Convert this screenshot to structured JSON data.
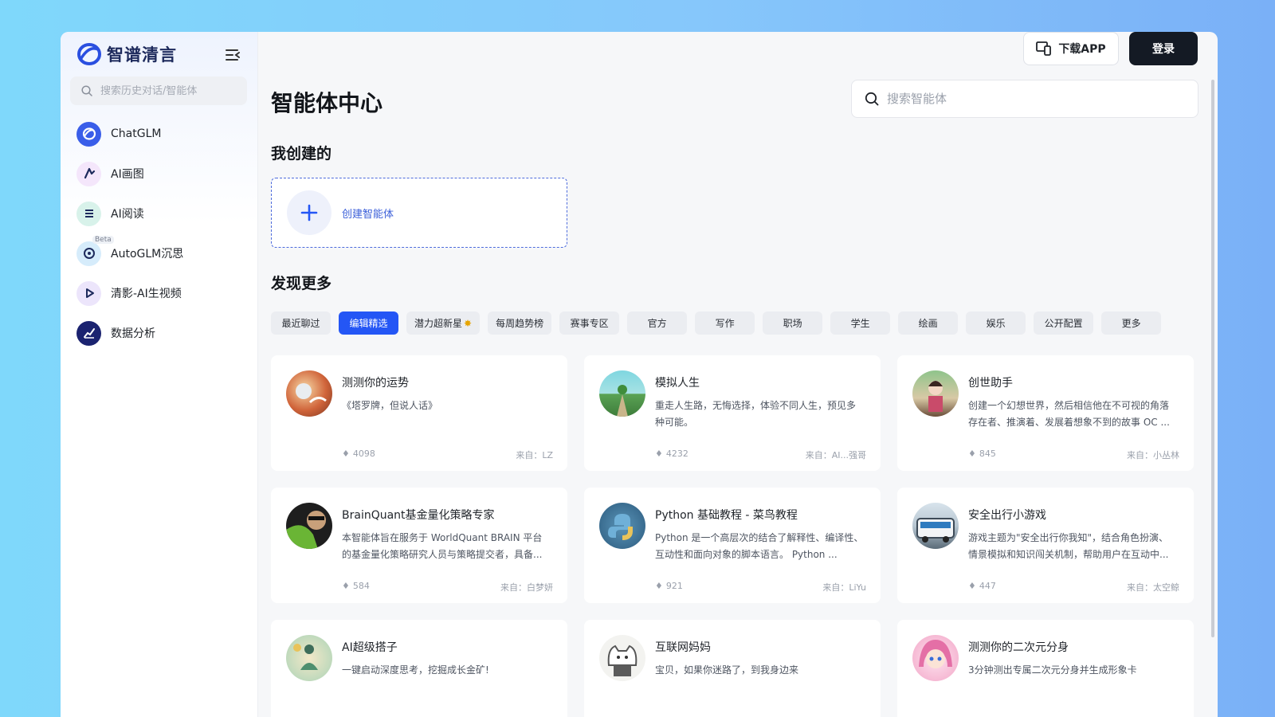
{
  "app": {
    "name": "智谱清言"
  },
  "sidebar": {
    "search_placeholder": "搜索历史对话/智能体",
    "items": [
      {
        "label": "ChatGLM",
        "icon": "chatglm-logo-icon",
        "color": "#3a5ee9"
      },
      {
        "label": "AI画图",
        "icon": "paint-icon",
        "color": "#f4e6fb"
      },
      {
        "label": "AI阅读",
        "icon": "reading-icon",
        "color": "#d8f2ea"
      },
      {
        "label": "AutoGLM沉思",
        "icon": "think-icon",
        "color": "#d6ecfb",
        "badge": "Beta"
      },
      {
        "label": "清影-AI生视频",
        "icon": "play-icon",
        "color": "#ece5fb"
      },
      {
        "label": "数据分析",
        "icon": "chart-icon",
        "color": "#1b2370"
      }
    ]
  },
  "header": {
    "download_label": "下载APP",
    "login_label": "登录"
  },
  "main": {
    "title": "智能体中心",
    "search_placeholder": "搜索智能体",
    "my_created_title": "我创建的",
    "create_label": "创建智能体",
    "discover_title": "发现更多",
    "tabs": [
      {
        "label": "最近聊过",
        "active": false
      },
      {
        "label": "编辑精选",
        "active": true
      },
      {
        "label": "潜力超新星",
        "active": false
      },
      {
        "label": "每周趋势榜",
        "active": false
      },
      {
        "label": "赛事专区",
        "active": false
      },
      {
        "label": "官方",
        "active": false
      },
      {
        "label": "写作",
        "active": false
      },
      {
        "label": "职场",
        "active": false
      },
      {
        "label": "学生",
        "active": false
      },
      {
        "label": "绘画",
        "active": false
      },
      {
        "label": "娱乐",
        "active": false
      },
      {
        "label": "公开配置",
        "active": false
      },
      {
        "label": "更多",
        "active": false
      }
    ],
    "cards": [
      {
        "title": "测测你的运势",
        "desc": "《塔罗牌，但说人话》",
        "count": "4098",
        "source": "来自：LZ"
      },
      {
        "title": "模拟人生",
        "desc": "重走人生路，无悔选择，体验不同人生，预见多种可能。",
        "count": "4232",
        "source": "来自：AI...强哥"
      },
      {
        "title": "创世助手",
        "desc": "创建一个幻想世界，然后相信他在不可视的角落存在者、推演着、发展着想象不到的故事 OC ...",
        "count": "845",
        "source": "来自：小丛林"
      },
      {
        "title": "BrainQuant基金量化策略专家",
        "desc": "本智能体旨在服务于 WorldQuant BRAIN 平台的基金量化策略研究人员与策略提交者，具备...",
        "count": "584",
        "source": "来自：白梦妍"
      },
      {
        "title": "Python 基础教程 - 菜鸟教程",
        "desc": "Python 是一个高层次的结合了解释性、编译性、互动性和面向对象的脚本语言。 Python ...",
        "count": "921",
        "source": "来自：LiYu"
      },
      {
        "title": "安全出行小游戏",
        "desc": "游戏主题为\"安全出行你我知\"，结合角色扮演、情景模拟和知识闯关机制，帮助用户在互动中...",
        "count": "447",
        "source": "来自：太空鲸"
      },
      {
        "title": "AI超级搭子",
        "desc": "一键启动深度思考，挖掘成长金矿!",
        "count": "",
        "source": ""
      },
      {
        "title": "互联网妈妈",
        "desc": "宝贝，如果你迷路了，到我身边来",
        "count": "",
        "source": ""
      },
      {
        "title": "测测你的二次元分身",
        "desc": "3分钟测出专属二次元分身并生成形象卡",
        "count": "",
        "source": ""
      }
    ]
  },
  "colors": {
    "accent": "#2456f5",
    "dark": "#141a24"
  }
}
